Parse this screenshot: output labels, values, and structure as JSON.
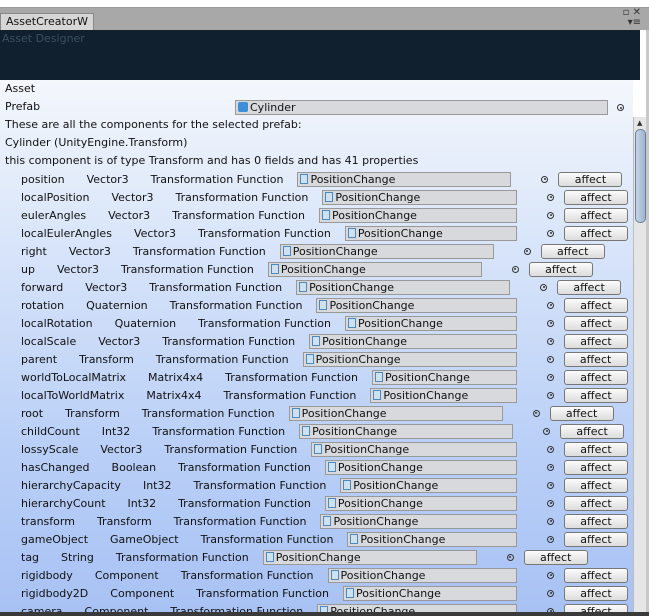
{
  "window": {
    "tab": "AssetCreatorW",
    "header": "Asset Designer"
  },
  "asset_label": "Asset",
  "prefab": {
    "label": "Prefab",
    "value": "Cylinder"
  },
  "info": [
    "These are all the components for the selected prefab:",
    "Cylinder (UnityEngine.Transform)",
    "this component is of type Transform and has 0 fields and has 41 properties"
  ],
  "rows": [
    {
      "name": "position",
      "type": "Vector3"
    },
    {
      "name": "localPosition",
      "type": "Vector3"
    },
    {
      "name": "eulerAngles",
      "type": "Vector3"
    },
    {
      "name": "localEulerAngles",
      "type": "Vector3"
    },
    {
      "name": "right",
      "type": "Vector3"
    },
    {
      "name": "up",
      "type": "Vector3"
    },
    {
      "name": "forward",
      "type": "Vector3"
    },
    {
      "name": "rotation",
      "type": "Quaternion"
    },
    {
      "name": "localRotation",
      "type": "Quaternion"
    },
    {
      "name": "localScale",
      "type": "Vector3"
    },
    {
      "name": "parent",
      "type": "Transform"
    },
    {
      "name": "worldToLocalMatrix",
      "type": "Matrix4x4"
    },
    {
      "name": "localToWorldMatrix",
      "type": "Matrix4x4"
    },
    {
      "name": "root",
      "type": "Transform"
    },
    {
      "name": "childCount",
      "type": "Int32"
    },
    {
      "name": "lossyScale",
      "type": "Vector3"
    },
    {
      "name": "hasChanged",
      "type": "Boolean"
    },
    {
      "name": "hierarchyCapacity",
      "type": "Int32"
    },
    {
      "name": "hierarchyCount",
      "type": "Int32"
    },
    {
      "name": "transform",
      "type": "Transform"
    },
    {
      "name": "gameObject",
      "type": "GameObject"
    },
    {
      "name": "tag",
      "type": "String"
    },
    {
      "name": "rigidbody",
      "type": "Component"
    },
    {
      "name": "rigidbody2D",
      "type": "Component"
    },
    {
      "name": "camera",
      "type": "Component"
    }
  ],
  "row_label": "Transformation Function",
  "row_field": "PositionChange",
  "row_button": "affect"
}
